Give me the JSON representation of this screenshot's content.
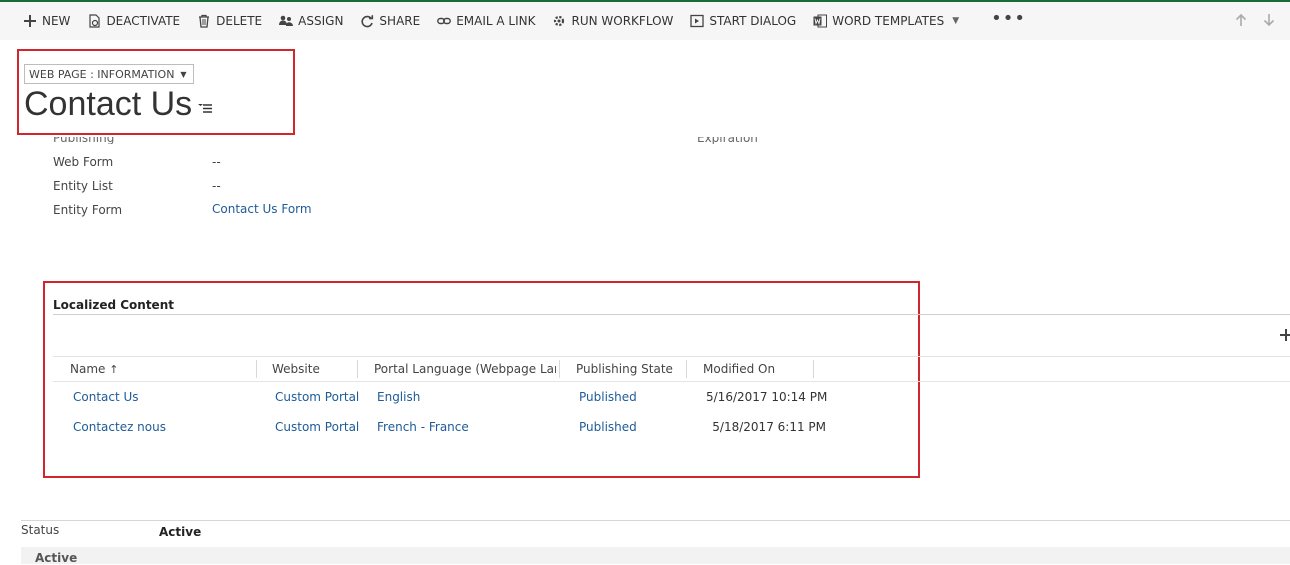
{
  "toolbar": {
    "buttons": [
      {
        "label": "NEW",
        "icon": "plus-icon"
      },
      {
        "label": "DEACTIVATE",
        "icon": "deactivate-icon"
      },
      {
        "label": "DELETE",
        "icon": "trash-icon"
      },
      {
        "label": "ASSIGN",
        "icon": "assign-icon"
      },
      {
        "label": "SHARE",
        "icon": "share-icon"
      },
      {
        "label": "EMAIL A LINK",
        "icon": "link-icon"
      },
      {
        "label": "RUN WORKFLOW",
        "icon": "workflow-icon"
      },
      {
        "label": "START DIALOG",
        "icon": "dialog-icon"
      },
      {
        "label": "WORD TEMPLATES",
        "icon": "word-icon"
      }
    ],
    "more": "•••"
  },
  "form": {
    "selector_label": "WEB PAGE : INFORMATION",
    "title": "Contact Us"
  },
  "fields": [
    {
      "label": "Web Form",
      "value": "--",
      "is_link": false
    },
    {
      "label": "Entity List",
      "value": "--",
      "is_link": false
    },
    {
      "label": "Entity Form",
      "value": "Contact Us Form",
      "is_link": true
    }
  ],
  "localized": {
    "section_title": "Localized Content",
    "columns": [
      "Name",
      "Website",
      "Portal Language (Webpage Lang...",
      "Publishing State",
      "Modified On"
    ],
    "rows": [
      {
        "name": "Contact Us",
        "website": "Custom Portal",
        "language": "English",
        "state": "Published",
        "modified": "5/16/2017 10:14 PM"
      },
      {
        "name": "Contactez nous",
        "website": "Custom Portal",
        "language": "French - France",
        "state": "Published",
        "modified": "5/18/2017 6:11 PM"
      }
    ]
  },
  "status": {
    "label": "Status",
    "value": "Active",
    "footer": "Active"
  },
  "colors": {
    "highlight": "#d2262f",
    "link": "#1e5b98",
    "brand_line": "#1a6b3a"
  }
}
